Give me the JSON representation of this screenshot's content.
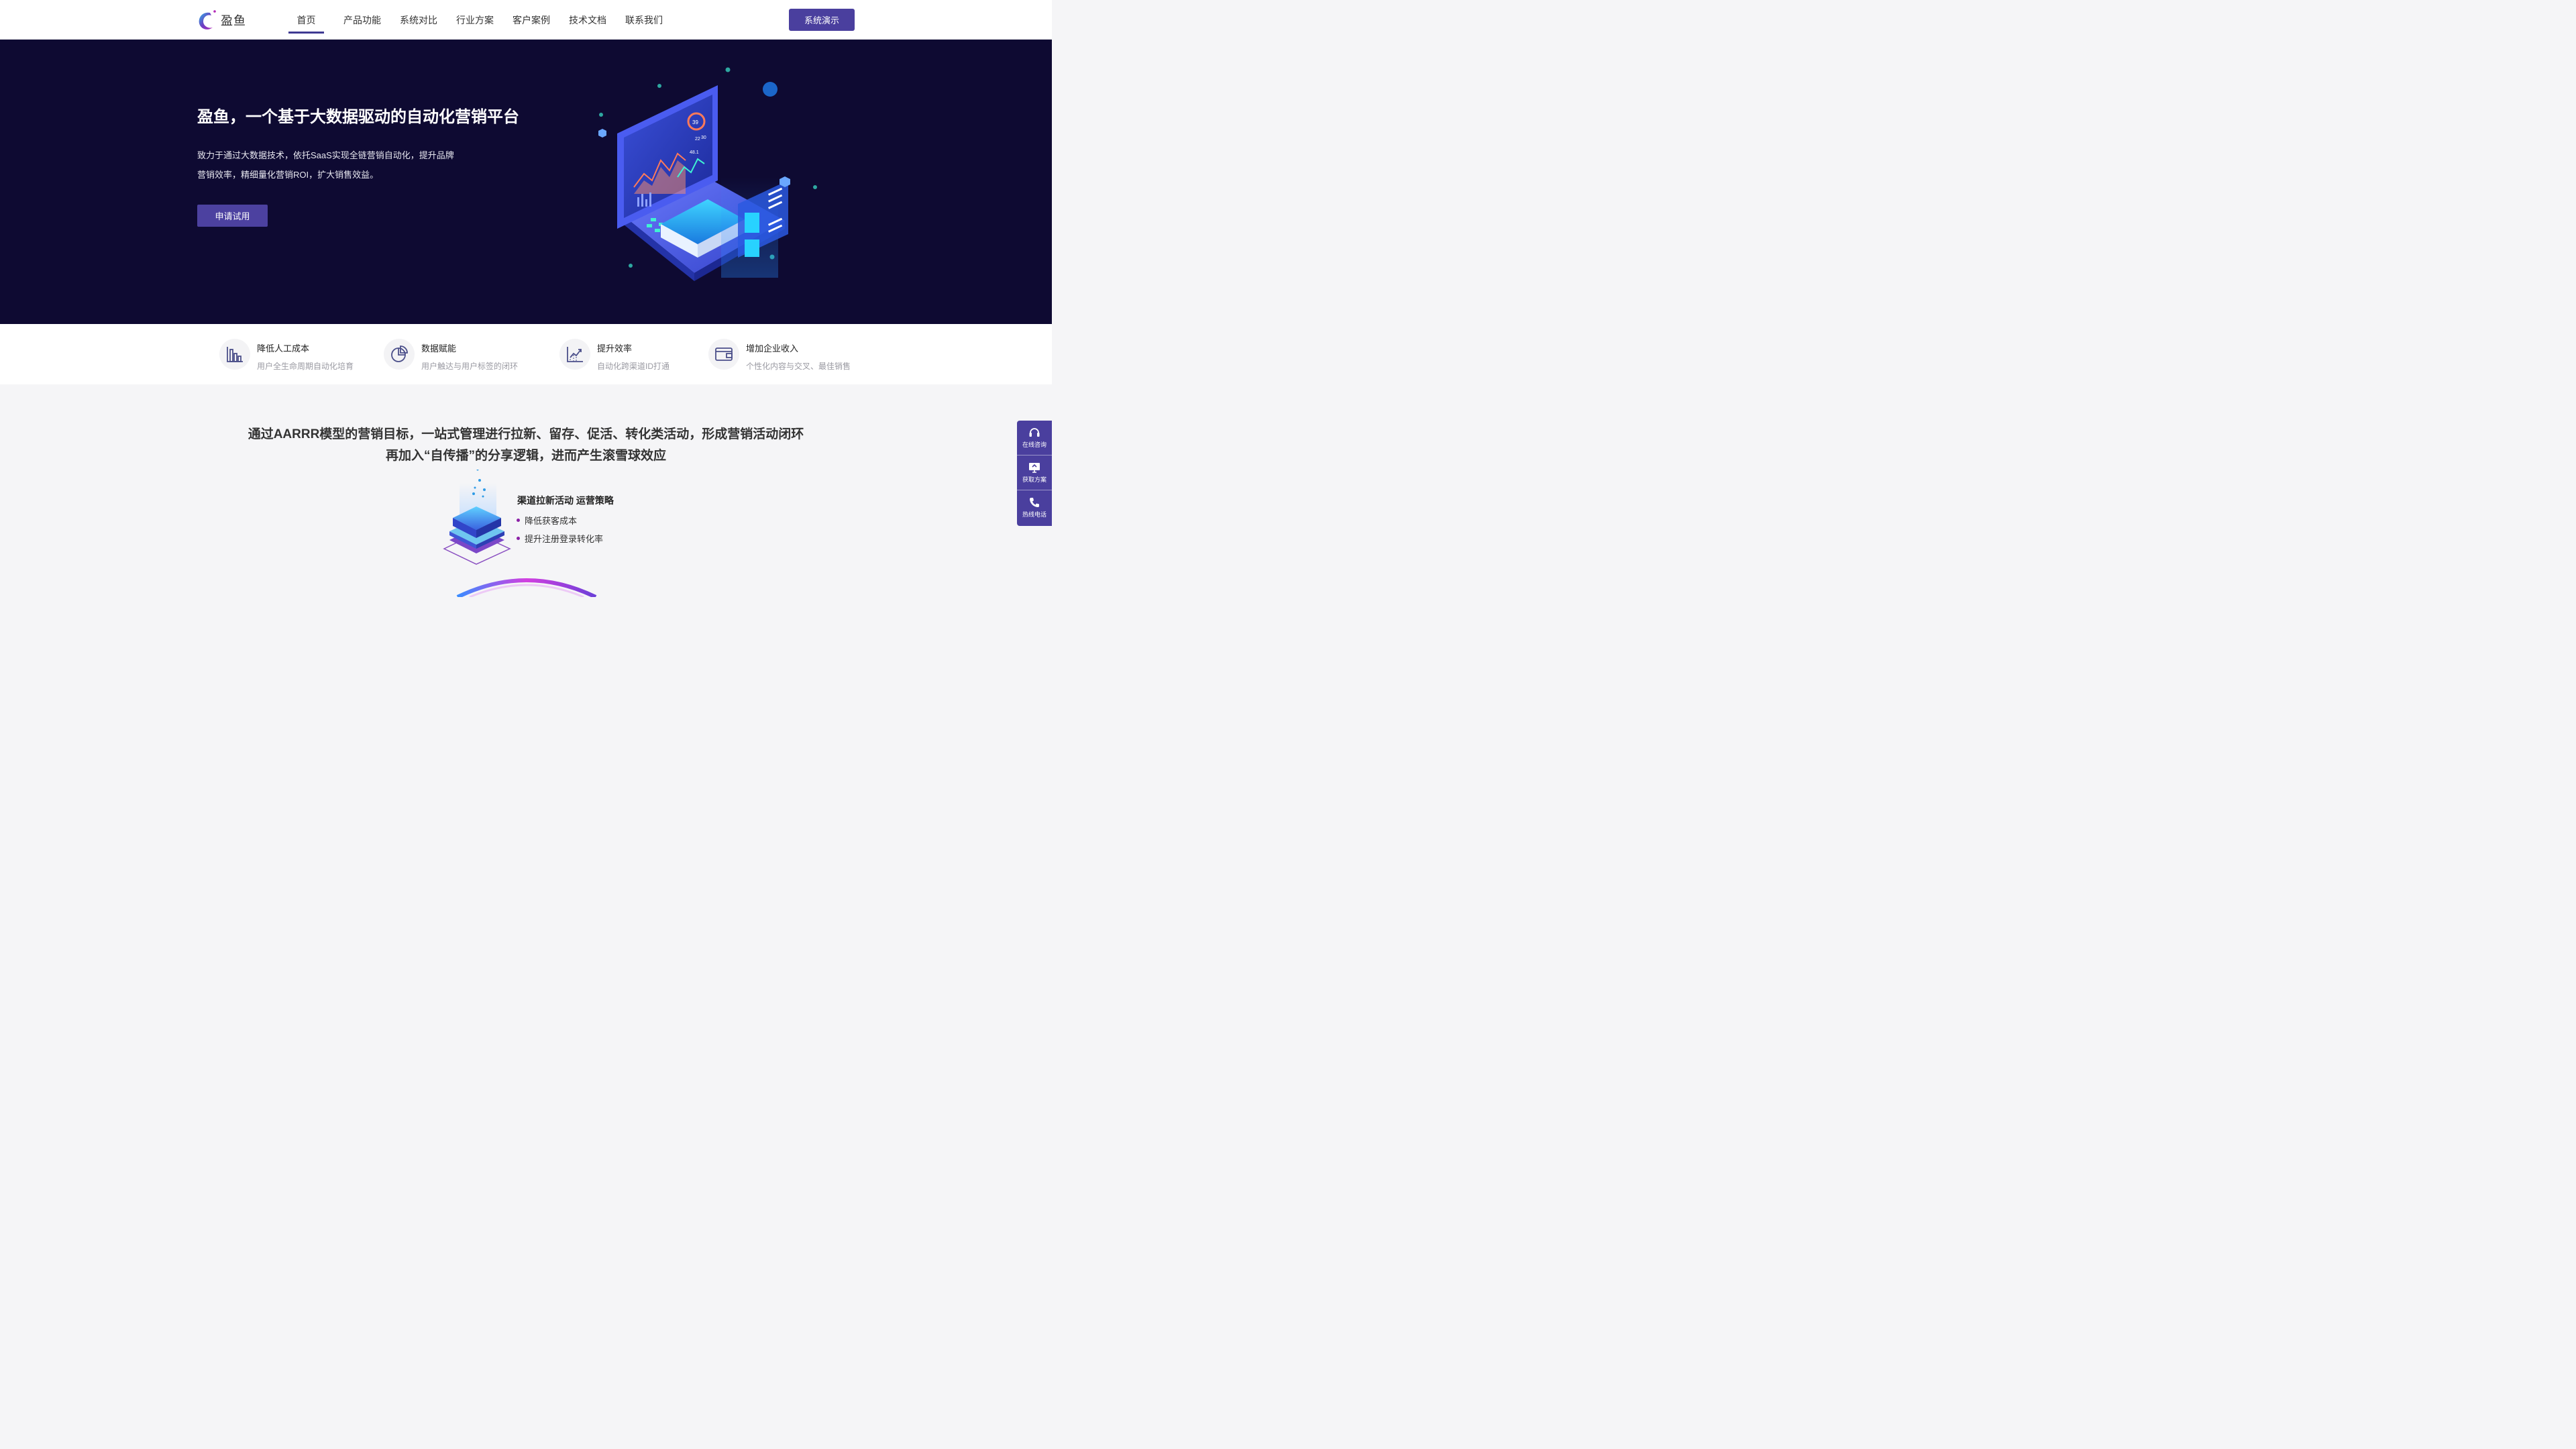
{
  "header": {
    "logo_text": "盈鱼",
    "nav": [
      {
        "label": "首页",
        "active": true
      },
      {
        "label": "产品功能",
        "active": false
      },
      {
        "label": "系统对比",
        "active": false
      },
      {
        "label": "行业方案",
        "active": false
      },
      {
        "label": "客户案例",
        "active": false
      },
      {
        "label": "技术文档",
        "active": false
      },
      {
        "label": "联系我们",
        "active": false
      }
    ],
    "demo_button": "系统演示"
  },
  "hero": {
    "title": "盈鱼，一个基于大数据驱动的自动化营销平台",
    "desc_line1": "致力于通过大数据技术，依托SaaS实现全链营销自动化，提升品牌",
    "desc_line2": "营销效率，精细量化营销ROI，扩大销售效益。",
    "trial_button": "申请试用",
    "screen_numbers": [
      "39",
      "22",
      "30",
      "48.1"
    ]
  },
  "features": [
    {
      "icon": "bar-chart-icon",
      "title": "降低人工成本",
      "subtitle": "用户全生命周期自动化培育"
    },
    {
      "icon": "pie-chart-icon",
      "title": "数据赋能",
      "subtitle": "用户触达与用户标签的闭环"
    },
    {
      "icon": "trend-chart-icon",
      "title": "提升效率",
      "subtitle": "自动化跨渠道ID打通"
    },
    {
      "icon": "wallet-icon",
      "title": "增加企业收入",
      "subtitle": "个性化内容与交叉、最佳销售"
    }
  ],
  "section": {
    "heading_line1": "通过AARRR模型的营销目标，一站式管理进行拉新、留存、促活、转化类活动，形成营销活动闭环",
    "heading_line2": "再加入“自传播”的分享逻辑，进而产生滚雪球效应",
    "strategy_title": "渠道拉新活动 运营策略",
    "strategy_points": [
      "降低获客成本",
      "提升注册登录转化率"
    ]
  },
  "side_panel": [
    {
      "icon": "headset-icon",
      "label": "在线咨询"
    },
    {
      "icon": "presentation-icon",
      "label": "获取方案"
    },
    {
      "icon": "phone-icon",
      "label": "热线电话"
    }
  ],
  "colors": {
    "brand": "#4a3f9e",
    "hero_bg": "#0e0a32",
    "accent_dot": "#8b1fa6"
  }
}
